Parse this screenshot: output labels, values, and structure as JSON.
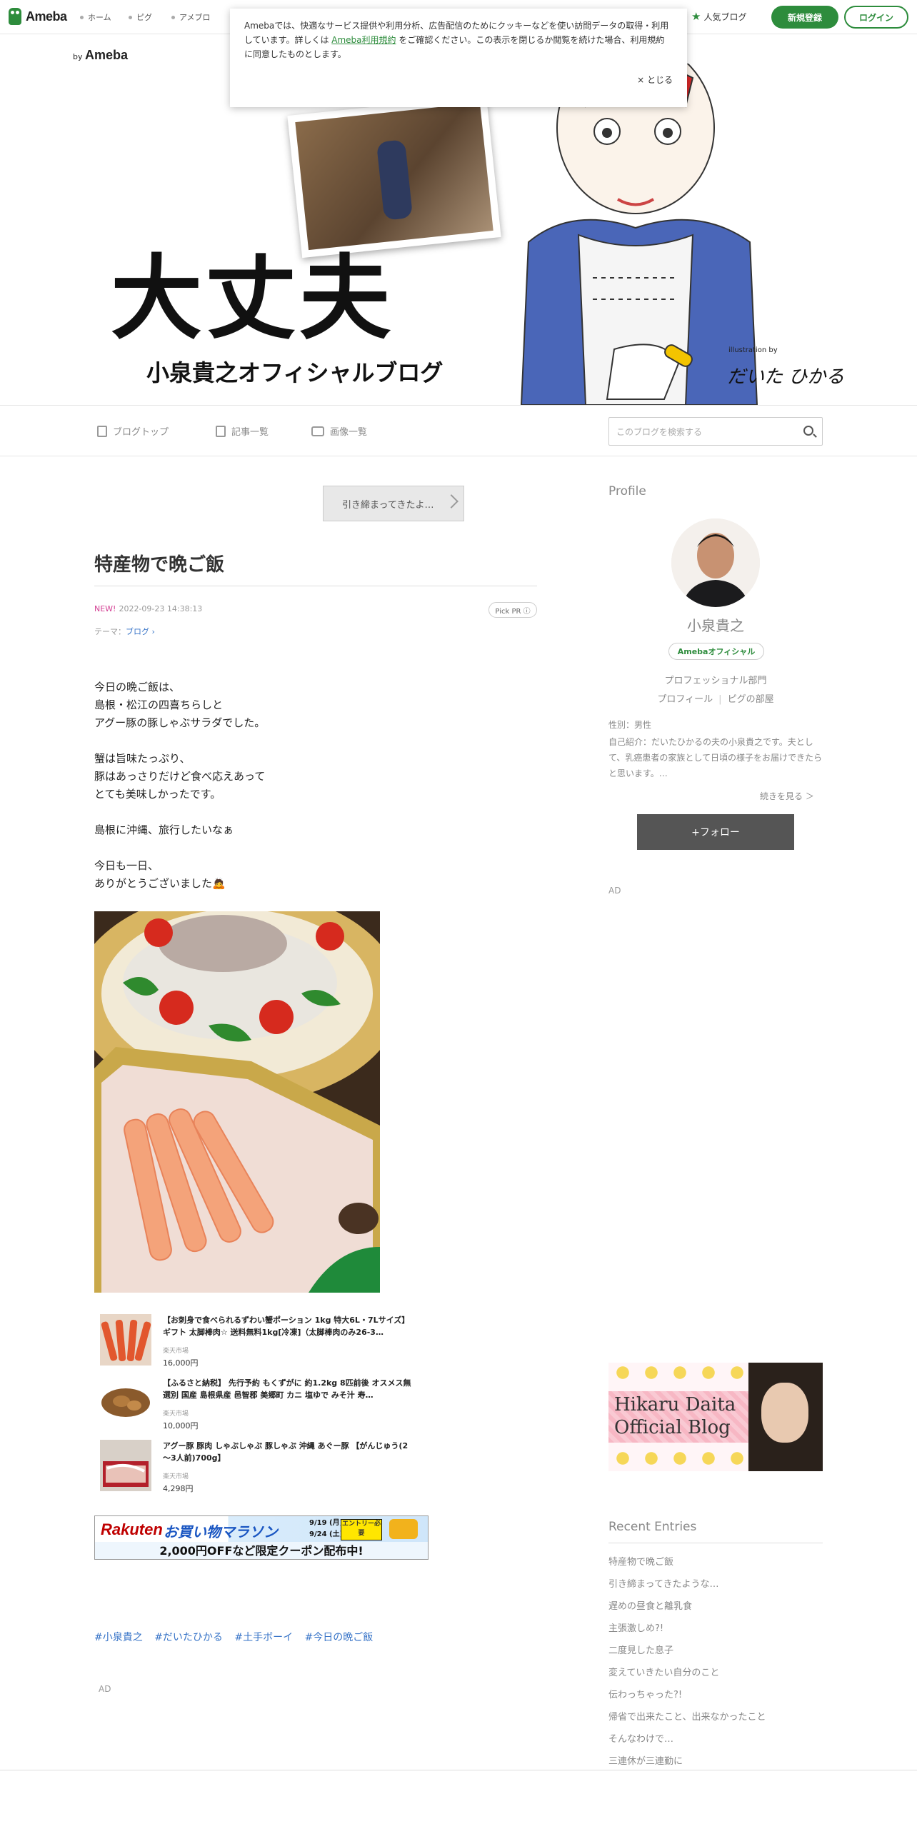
{
  "topbar": {
    "logo": "Ameba",
    "nav": [
      "ホーム",
      "ピグ",
      "アメブロ"
    ],
    "popular": "人気ブログ",
    "signup": "新規登録",
    "login": "ログイン"
  },
  "cookie": {
    "text_before": "Amebaでは、快適なサービス提供や利用分析、広告配信のためにクッキーなどを使い訪問データの取得・利用しています。詳しくは ",
    "link": "Ameba利用規約",
    "text_after": " をご確認ください。この表示を閉じるか閲覧を続けた場合、利用規約に同意したものとします。",
    "close": "× とじる"
  },
  "banner": {
    "by": "by",
    "by_brand": "Ameba",
    "title": "大丈夫",
    "subtitle": "小泉貴之オフィシャルブログ",
    "illustration_by": "illustration by",
    "illustrator": "だいた ひかる"
  },
  "blognav": {
    "top": "ブログトップ",
    "entries": "記事一覧",
    "images": "画像一覧",
    "search_placeholder": "このブログを検索する"
  },
  "entry": {
    "prev": "引き締まってきたよ…",
    "title": "特産物で晩ご飯",
    "new_label": "NEW!",
    "date": "2022-09-23 14:38:13",
    "pickpr": "Pick PR ⓘ",
    "theme_label": "テーマ：",
    "theme": "ブログ ›",
    "paragraphs": [
      [
        "今日の晩ご飯は、",
        "島根・松江の四喜ちらしと",
        "アグー豚の豚しゃぶサラダでした。"
      ],
      [
        "蟹は旨味たっぷり、",
        "豚はあっさりだけど食べ応えあって",
        "とても美味しかったです。"
      ],
      [
        "島根に沖縄、旅行したいなぁ"
      ],
      [
        "今日も一日、",
        "ありがとうございました🙇"
      ]
    ],
    "products": [
      {
        "name": "【お刺身で食べられるずわい蟹ポーション 1kg 特大6L・7Lサイズ】ギフト 太脚棒肉☆ 送料無料1kg[冷凍]（太脚棒肉のみ26-3…",
        "shop": "楽天市場",
        "price": "16,000円"
      },
      {
        "name": "【ふるさと納税】 先行予約 もくずがに 約1.2kg 8匹前後 オスメス無選別 国産 島根県産 邑智郡 美郷町 カニ 塩ゆで みそ汁 寿…",
        "shop": "楽天市場",
        "price": "10,000円"
      },
      {
        "name": "アグー豚 豚肉 しゃぶしゃぶ 豚しゃぶ 沖縄 あぐー豚 【がんじゅう(2～3人前)700g】",
        "shop": "楽天市場",
        "price": "4,298円"
      }
    ],
    "rakuten": {
      "brand": "Rakuten",
      "campaign": "お買い物マラソン",
      "date1": "9/19 (月)20:00",
      "date2": "9/24 (土)01:59",
      "entry": "エントリー必要",
      "offer": "2,000円OFFなど限定クーポン配布中!"
    },
    "tags": [
      "#小泉貴之",
      "#だいたひかる",
      "#土手ボーイ",
      "#今日の晩ご飯"
    ],
    "ad": "AD"
  },
  "sidebar": {
    "profile_heading": "Profile",
    "name": "小泉貴之",
    "official": "Amebaオフィシャル",
    "dept": "プロフェッショナル部門",
    "link_profile": "プロフィール",
    "link_pig": "ピグの部屋",
    "gender": "性別：男性",
    "intro": "自己紹介：だいたひかるの夫の小泉貴之です。夫として、乳癌患者の家族として日頃の様子をお届けできたらと思います。…",
    "more": "続きを見る ＞",
    "follow": "+フォロー",
    "ad": "AD",
    "banner_line1": "Hikaru Daita",
    "banner_line2": "Official Blog",
    "recent_heading": "Recent Entries",
    "recent": [
      "特産物で晩ご飯",
      "引き締まってきたような…",
      "遅めの昼食と離乳食",
      "主張激しめ?!",
      "二度見した息子",
      "変えていきたい自分のこと",
      "伝わっちゃった?!",
      "帰省で出来たこと、出来なかったこと",
      "そんなわけで…",
      "三連休が三連勤に"
    ]
  },
  "colors": {
    "brand_green": "#2d8c3c",
    "link_blue": "#3673c7",
    "new_pink": "#d33f93"
  }
}
